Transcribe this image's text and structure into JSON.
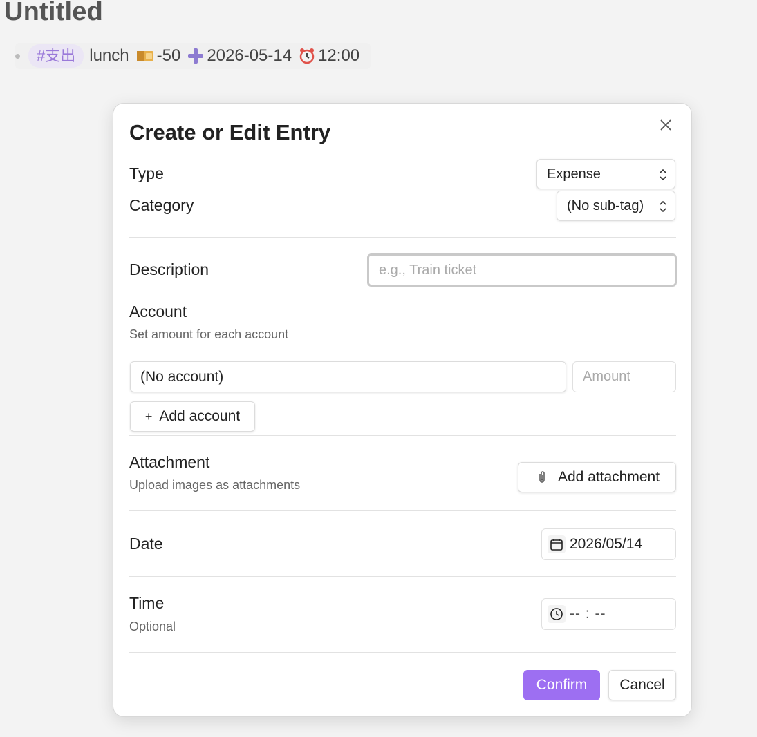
{
  "page": {
    "title": "Untitled",
    "entry": {
      "tag": "#支出",
      "description": "lunch",
      "amount": "-50",
      "date": "2026-05-14",
      "time": "12:00",
      "icons": [
        "wallet-icon",
        "plus-cross-icon",
        "alarm-clock-icon"
      ]
    }
  },
  "modal": {
    "title": "Create or Edit Entry",
    "type": {
      "label": "Type",
      "value": "Expense"
    },
    "category": {
      "label": "Category",
      "value": "(No sub-tag)"
    },
    "description": {
      "label": "Description",
      "placeholder": "e.g., Train ticket"
    },
    "account": {
      "label": "Account",
      "hint": "Set amount for each account",
      "selected": "(No account)",
      "amount_placeholder": "Amount",
      "add_label": "Add account"
    },
    "attachment": {
      "label": "Attachment",
      "hint": "Upload images as attachments",
      "button_label": "Add attachment"
    },
    "date": {
      "label": "Date",
      "value": "2026/05/14"
    },
    "time": {
      "label": "Time",
      "hint": "Optional",
      "value": "-- : --"
    },
    "confirm_label": "Confirm",
    "cancel_label": "Cancel"
  },
  "colors": {
    "accent": "#9d6ff2",
    "tag_bg": "#ebe6f5",
    "tag_text": "#9a79d9"
  }
}
